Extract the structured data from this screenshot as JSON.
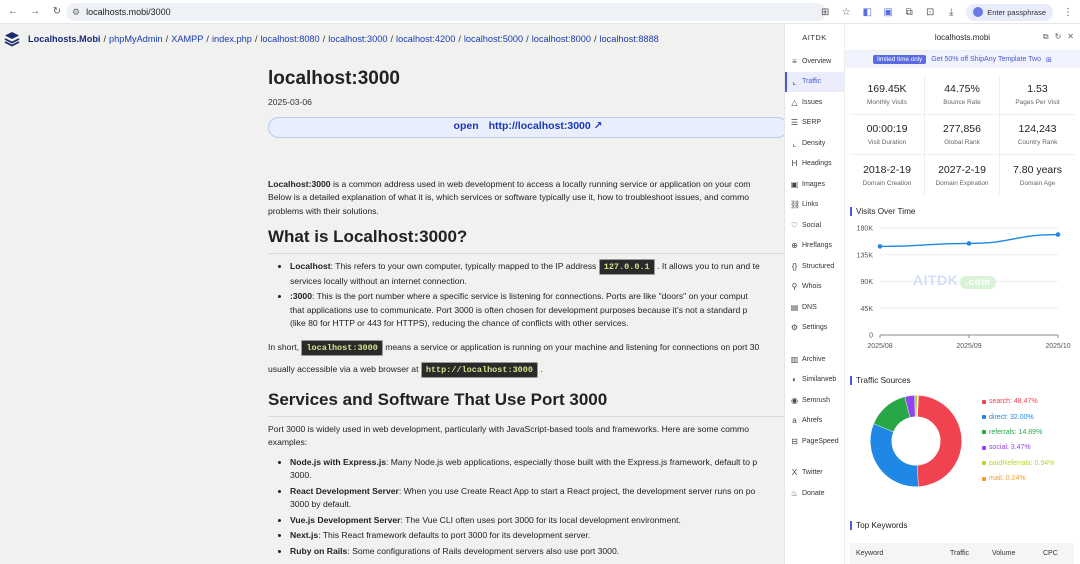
{
  "browser": {
    "url": "localhosts.mobi/3000",
    "passphrase_label": "Enter passphrase"
  },
  "breadcrumb": {
    "site": "Localhosts.Mobi",
    "items": [
      "phpMyAdmin",
      "XAMPP",
      "index.php",
      "localhost:8080",
      "localhost:3000",
      "localhost:4200",
      "localhost:5000",
      "localhost:8000",
      "localhost:8888"
    ]
  },
  "article": {
    "title": "localhost:3000",
    "date": "2025-03-06",
    "open_label": "open",
    "open_url": "http://localhost:3000 ↗",
    "intro_bold": "Localhost:3000",
    "intro_text": " is a common address used in web development to access a locally running service or application on your com",
    "intro_line2": "Below is a detailed explanation of what it is, which services or software typically use it, how to troubleshoot issues, and commo",
    "intro_line3": "problems with their solutions.",
    "h2_what": "What is Localhost:3000?",
    "li1_bold": "Localhost",
    "li1_text_a": ": This refers to your own computer, typically mapped to the IP address ",
    "li1_code": "127.0.0.1",
    "li1_text_b": " . It allows you to run and te",
    "li1_line2": "services locally without an internet connection.",
    "li2_bold": ":3000",
    "li2_text": ": This is the port number where a specific service is listening for connections. Ports are like \"doors\" on your comput",
    "li2_line2": "that applications use to communicate. Port 3000 is often chosen for development purposes because it's not a standard p",
    "li2_line3": "(like 80 for HTTP or 443 for HTTPS), reducing the chance of conflicts with other services.",
    "short_a": "In short, ",
    "short_code": "localhost:3000",
    "short_b": " means a service or application is running on your machine and listening for connections on port 30",
    "short_c": "usually accessible via a web browser at ",
    "short_code2": "http://localhost:3000",
    "short_d": " .",
    "h2_services": "Services and Software That Use Port 3000",
    "services_intro": "Port 3000 is widely used in web development, particularly with JavaScript-based tools and frameworks. Here are some commo",
    "services_intro2": "examples:",
    "s1_bold": "Node.js with Express.js",
    "s1_text": ": Many Node.js web applications, especially those built with the Express.js framework, default to p",
    "s1_line2": "3000.",
    "s2_bold": "React Development Server",
    "s2_text": ": When you use Create React App to start a React project, the development server runs on po",
    "s2_line2": "3000 by default.",
    "s3_bold": "Vue.js Development Server",
    "s3_text": ": The Vue CLI often uses port 3000 for its local development environment.",
    "s4_bold": "Next.js",
    "s4_text": ": This React framework defaults to port 3000 for its development server.",
    "s5_bold": "Ruby on Rails",
    "s5_text": ": Some configurations of Rails development servers also use port 3000."
  },
  "aitdk_nav": {
    "brand": "AITDK",
    "items": [
      {
        "label": "Overview",
        "icon": "≡"
      },
      {
        "label": "Traffic",
        "icon": "⌞"
      },
      {
        "label": "Issues",
        "icon": "△"
      },
      {
        "label": "SERP",
        "icon": "☰"
      },
      {
        "label": "Density",
        "icon": "⌞"
      },
      {
        "label": "Headings",
        "icon": "H"
      },
      {
        "label": "Images",
        "icon": "▣"
      },
      {
        "label": "Links",
        "icon": "⛓"
      },
      {
        "label": "Social",
        "icon": "♡"
      },
      {
        "label": "Hreflangs",
        "icon": "⊕"
      },
      {
        "label": "Structured",
        "icon": "{}"
      },
      {
        "label": "Whois",
        "icon": "⚲"
      },
      {
        "label": "DNS",
        "icon": "▤"
      },
      {
        "label": "Settings",
        "icon": "⚙"
      }
    ],
    "items2": [
      {
        "label": "Archive",
        "icon": "▥"
      },
      {
        "label": "Similarweb",
        "icon": "◐"
      },
      {
        "label": "Semrush",
        "icon": "◉"
      },
      {
        "label": "Ahrefs",
        "icon": "a"
      },
      {
        "label": "PageSpeed",
        "icon": "⊟"
      }
    ],
    "items3": [
      {
        "label": "Twitter",
        "icon": "X"
      },
      {
        "label": "Donate",
        "icon": "♨"
      }
    ]
  },
  "panel": {
    "domain": "localhosts.mobi",
    "promo_tag": "limited time only",
    "promo_text": "Get 50% off ShipAny Template Two",
    "stats": [
      {
        "value": "169.45K",
        "label": "Monthly Visits"
      },
      {
        "value": "44.75%",
        "label": "Bounce Rate"
      },
      {
        "value": "1.53",
        "label": "Pages Per Visit"
      },
      {
        "value": "00:00:19",
        "label": "Visit Duration"
      },
      {
        "value": "277,856",
        "label": "Global Rank"
      },
      {
        "value": "124,243",
        "label": "Country Rank"
      },
      {
        "value": "2018-2-19",
        "label": "Domain Creation"
      },
      {
        "value": "2027-2-19",
        "label": "Domain Expiration"
      },
      {
        "value": "7.80 years",
        "label": "Domain Age"
      }
    ],
    "visits_title": "Visits Over Time",
    "watermark": "AITDK",
    "watermark_com": ".com",
    "sources_title": "Traffic Sources",
    "keywords_title": "Top Keywords",
    "kw_cols": [
      "Keyword",
      "Traffic",
      "Volume",
      "CPC"
    ]
  },
  "chart_data": [
    {
      "type": "line",
      "title": "Visits Over Time",
      "x": [
        "2025/08",
        "2025/09",
        "2025/10"
      ],
      "values": [
        149000,
        154000,
        169000
      ],
      "yticks": [
        "180K",
        "135K",
        "90K",
        "45K",
        "0"
      ],
      "ylim": [
        0,
        180000
      ],
      "grid": true,
      "color": "#1e88e5"
    },
    {
      "type": "pie",
      "title": "Traffic Sources",
      "slices": [
        {
          "name": "search",
          "value": 48.47,
          "label": "search: 48.47%",
          "color": "#f0434f"
        },
        {
          "name": "direct",
          "value": 32.0,
          "label": "direct: 32.00%",
          "color": "#1f88e5"
        },
        {
          "name": "referrals",
          "value": 14.89,
          "label": "referrals: 14.89%",
          "color": "#27a745"
        },
        {
          "name": "social",
          "value": 3.47,
          "label": "social: 3.47%",
          "color": "#8e44ef"
        },
        {
          "name": "paidReferrals",
          "value": 0.94,
          "label": "paidReferrals: 0.94%",
          "color": "#b6d334"
        },
        {
          "name": "mail",
          "value": 0.24,
          "label": "mail: 0.24%",
          "color": "#f39c34"
        }
      ]
    }
  ]
}
